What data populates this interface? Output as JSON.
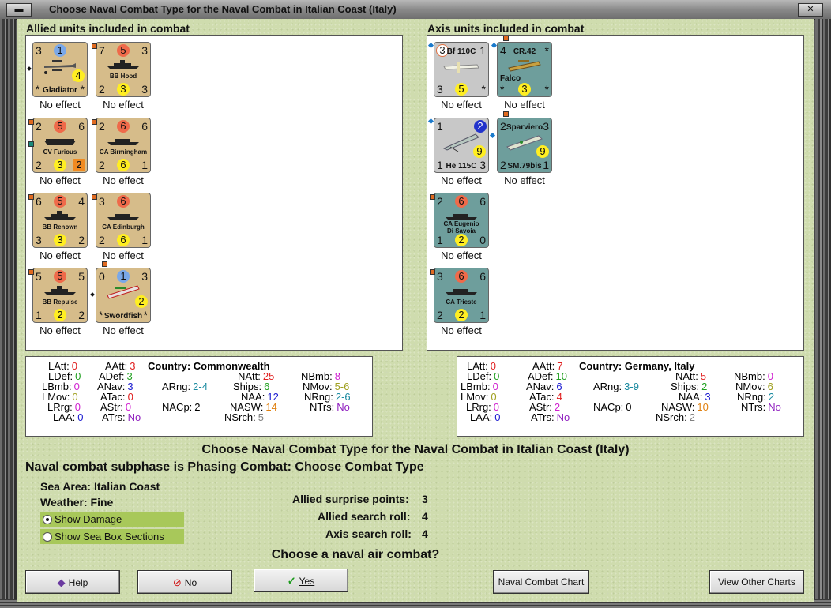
{
  "window": {
    "title": "Choose Naval Combat Type for the Naval Combat in Italian Coast (Italy)",
    "close_glyph": "✕"
  },
  "allied": {
    "label": "Allied units included in combat",
    "units": [
      {
        "name": "Gladiator",
        "tl": "3",
        "tr": "",
        "top": "1",
        "bl": "*",
        "br": "*",
        "mid": "4",
        "bot": "",
        "effect": "No effect"
      },
      {
        "name": "BB Hood",
        "tl": "7",
        "tr": "3",
        "top": "5",
        "bl": "2",
        "br": "3",
        "bot": "3",
        "effect": "No effect"
      },
      {
        "name": "CV Furious",
        "tl": "2",
        "tr": "6",
        "top": "5",
        "bl": "2",
        "br": "",
        "bot": "3",
        "extra": "2",
        "effect": "No effect"
      },
      {
        "name": "CA Birmingham",
        "tl": "2",
        "tr": "6",
        "top": "6",
        "bl": "2",
        "br": "1",
        "bot": "6",
        "effect": "No effect"
      },
      {
        "name": "BB Renown",
        "tl": "6",
        "tr": "4",
        "top": "5",
        "bl": "3",
        "br": "2",
        "bot": "3",
        "effect": "No effect"
      },
      {
        "name": "CA Edinburgh",
        "tl": "3",
        "tr": "",
        "top": "6",
        "bl": "2",
        "br": "1",
        "bot": "6",
        "effect": "No effect"
      },
      {
        "name": "BB Repulse",
        "tl": "5",
        "tr": "5",
        "top": "5",
        "bl": "1",
        "br": "2",
        "bot": "2",
        "effect": "No effect"
      },
      {
        "name": "Swordfish",
        "tl": "0",
        "tr": "3",
        "top": "1",
        "bl": "*",
        "br": "*",
        "mid": "2",
        "bot": "",
        "effect": "No effect"
      }
    ]
  },
  "axis": {
    "label": "Axis units included in combat",
    "units": [
      {
        "name": "Bf 110C",
        "tl": "3",
        "tr": "1",
        "bl": "3",
        "br": "*",
        "bot": "5",
        "effect": "No effect"
      },
      {
        "name": "CR.42",
        "tl": "4",
        "tr": "*",
        "sub": "Falco",
        "bl": "*",
        "br": "*",
        "bot": "3",
        "effect": "No effect"
      },
      {
        "name": "He 115C",
        "tl": "1",
        "tr": "2",
        "bl": "1",
        "br": "3",
        "mid": "9",
        "effect": "No effect"
      },
      {
        "name": "SM.79bis",
        "top_name": "Sparviero",
        "tl": "2",
        "tr": "3",
        "bl": "2",
        "br": "1",
        "mid": "9",
        "effect": "No effect"
      },
      {
        "name": "CA Eugenio",
        "sub": "Di Savoia",
        "tl": "2",
        "tr": "6",
        "top": "6",
        "bl": "1",
        "br": "0",
        "bot": "2",
        "effect": "No effect"
      },
      {
        "name": "CA Trieste",
        "tl": "3",
        "tr": "6",
        "top": "6",
        "bl": "2",
        "br": "1",
        "bot": "2",
        "effect": "No effect"
      }
    ]
  },
  "allied_stats": {
    "LAtt": "0",
    "LDef": "0",
    "LBmb": "0",
    "LMov": "0",
    "LRrg": "0",
    "LAA": "0",
    "AAtt": "3",
    "ADef": "3",
    "ANav": "3",
    "ATac": "0",
    "AStr": "0",
    "ATrs": "No",
    "country_label": "Country:",
    "country": "Commonwealth",
    "ARng": "2-4",
    "NACp": "2",
    "NAtt": "25",
    "Ships": "6",
    "NAA": "12",
    "NASW": "14",
    "NSrch": "5",
    "NBmb": "8",
    "NMov": "5-6",
    "NRng": "2-6",
    "NTrs": "No"
  },
  "axis_stats": {
    "LAtt": "0",
    "LDef": "0",
    "LBmb": "0",
    "LMov": "0",
    "LRrg": "0",
    "LAA": "0",
    "AAtt": "7",
    "ADef": "10",
    "ANav": "6",
    "ATac": "4",
    "AStr": "2",
    "ATrs": "No",
    "country_label": "Country:",
    "country": "Germany, Italy",
    "ARng": "3-9",
    "NACp": "0",
    "NAtt": "5",
    "Ships": "2",
    "NAA": "3",
    "NASW": "10",
    "NSrch": "2",
    "NBmb": "0",
    "NMov": "6",
    "NRng": "2",
    "NTrs": "No"
  },
  "main": {
    "heading": "Choose Naval Combat Type for the Naval Combat in Italian Coast (Italy)",
    "subphase": "Naval combat subphase is Phasing Combat: Choose Combat Type",
    "sea_area_label": "Sea Area:",
    "sea_area": "Italian Coast",
    "weather_label": "Weather:",
    "weather": "Fine",
    "show_damage": "Show Damage",
    "show_sea_box": "Show Sea Box Sections",
    "surprise_label": "Allied surprise points:",
    "surprise": "3",
    "allied_search_label": "Allied search roll:",
    "allied_search": "4",
    "axis_search_label": "Axis search roll:",
    "axis_search": "4",
    "question": "Choose a naval air combat?"
  },
  "buttons": {
    "help": "Help",
    "no": "No",
    "yes": "Yes",
    "naval_chart": "Naval Combat Chart",
    "other_charts": "View Other Charts"
  }
}
